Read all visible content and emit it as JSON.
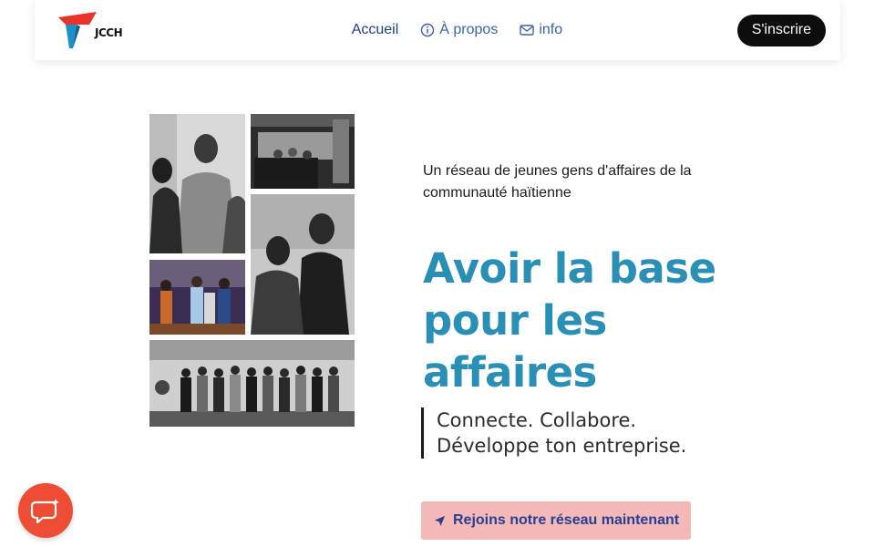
{
  "header": {
    "logo_text": "JCCH",
    "nav": [
      {
        "label": "Accueil",
        "icon": "",
        "active": true
      },
      {
        "label": "À propos",
        "icon": "info-circle-icon",
        "active": false
      },
      {
        "label": "info",
        "icon": "envelope-icon",
        "active": false
      }
    ],
    "signup_label": "S'inscrire"
  },
  "hero": {
    "tagline": "Un réseau de jeunes gens d'affaires de la communauté haïtienne",
    "headline_line1": "Avoir la base",
    "headline_line2": "pour les",
    "headline_line3": "affaires",
    "quote_line1": "Connecte. Collabore.",
    "quote_line2": "Développe ton entreprise.",
    "cta_label": "Rejoins notre réseau maintenant",
    "cta_icon": "paper-plane-icon"
  },
  "help_widget": {
    "icon": "chat-bubble-icon"
  },
  "colors": {
    "headline": "#2a8fb5",
    "nav_link": "#3b63a8",
    "cta_bg": "#f4b8b7",
    "cta_text": "#243f93",
    "help_bg": "#ee4c35",
    "logo_red": "#e8332a",
    "logo_blue": "#1d8fc8"
  }
}
